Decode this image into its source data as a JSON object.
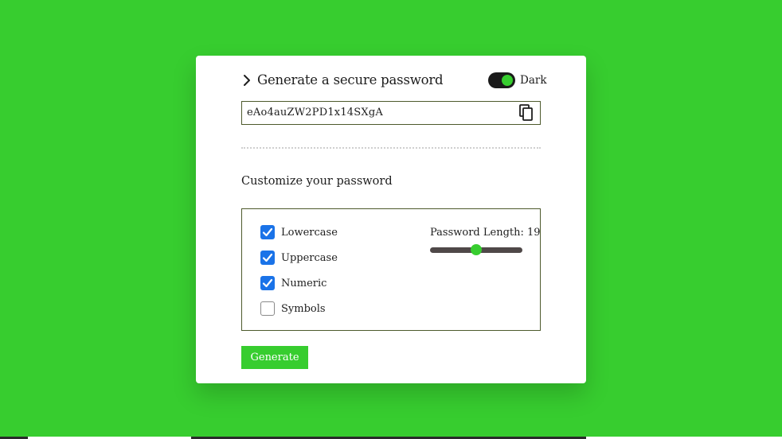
{
  "header": {
    "title": "Generate a secure password",
    "theme_toggle_label": "Dark",
    "theme_toggle_on": true
  },
  "password": {
    "value": "eAo4auZW2PD1x14SXgA"
  },
  "customize": {
    "heading": "Customize your password",
    "options": [
      {
        "label": "Lowercase",
        "checked": true
      },
      {
        "label": "Uppercase",
        "checked": true
      },
      {
        "label": "Numeric",
        "checked": true
      },
      {
        "label": "Symbols",
        "checked": false
      }
    ],
    "length_label": "Password Length: 19",
    "length_value": 19,
    "length_fraction": 0.5
  },
  "actions": {
    "generate_label": "Generate"
  },
  "colors": {
    "background": "#37cd2f",
    "accent": "#37cd2f",
    "checkbox": "#1a73e8",
    "toggle_track": "#1a1a1a"
  },
  "icons": {
    "header": "chevron-right-icon",
    "copy": "copy-icon",
    "check": "checkmark-icon"
  }
}
